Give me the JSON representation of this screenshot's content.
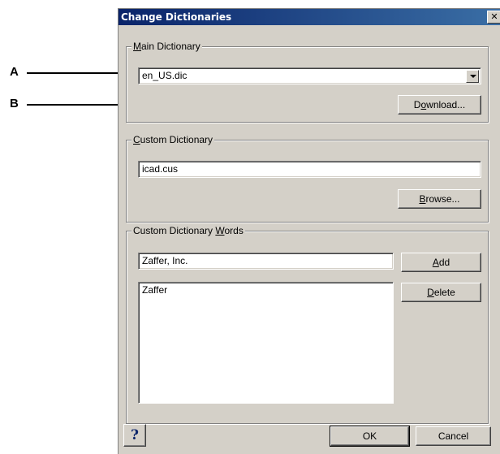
{
  "callouts": {
    "a": "A",
    "b": "B"
  },
  "dialog": {
    "title": "Change Dictionaries",
    "close_glyph": "✕"
  },
  "main_dictionary": {
    "legend_first": "M",
    "legend_rest": "ain Dictionary",
    "selected": "en_US.dic",
    "download_pre": "D",
    "download_u": "o",
    "download_post": "wnload..."
  },
  "custom_dictionary": {
    "legend_first": "C",
    "legend_rest": "ustom Dictionary",
    "value": "icad.cus",
    "browse_first": "B",
    "browse_rest": "rowse..."
  },
  "custom_words": {
    "legend_pre": "Custom Dictionary ",
    "legend_u": "W",
    "legend_post": "ords",
    "input_value": "Zaffer, Inc.",
    "add_first": "A",
    "add_rest": "dd",
    "delete_first": "D",
    "delete_rest": "elete",
    "list_items": [
      "Zaffer"
    ]
  },
  "footer": {
    "help_glyph": "?",
    "ok_label": "OK",
    "cancel_label": "Cancel"
  },
  "colors": {
    "dialog_bg": "#d4d0c8",
    "titlebar_start": "#0a246a",
    "titlebar_end": "#3a6ea5"
  }
}
